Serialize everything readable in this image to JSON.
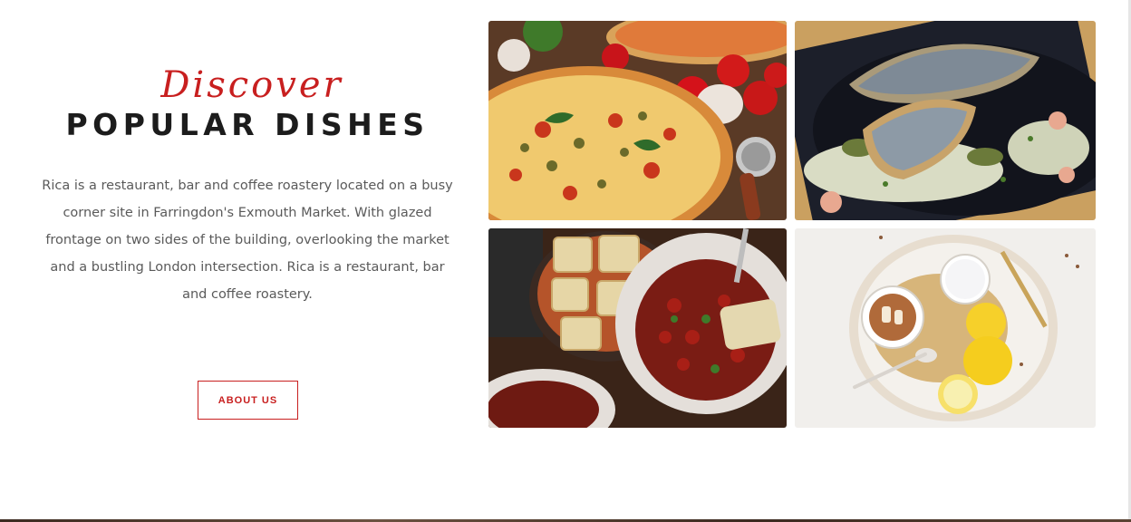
{
  "intro": {
    "script_title": "Discover",
    "main_title": "POPULAR DISHES",
    "description": "Rica is a restaurant, bar and coffee roastery located on a busy corner site in Farringdon's Exmouth Market. With glazed frontage on two sides of the building, overlooking the market and a bustling London intersection. Rica is a restaurant, bar and coffee roastery.",
    "button_label": "ABOUT US"
  },
  "gallery": {
    "images": [
      {
        "subject": "pizza"
      },
      {
        "subject": "grilled fish"
      },
      {
        "subject": "bean stew with cobbler"
      },
      {
        "subject": "dessert with lemons"
      }
    ]
  },
  "colors": {
    "accent": "#c81f1f",
    "heading": "#1c1c1c",
    "body_text": "#5a5a5a"
  }
}
